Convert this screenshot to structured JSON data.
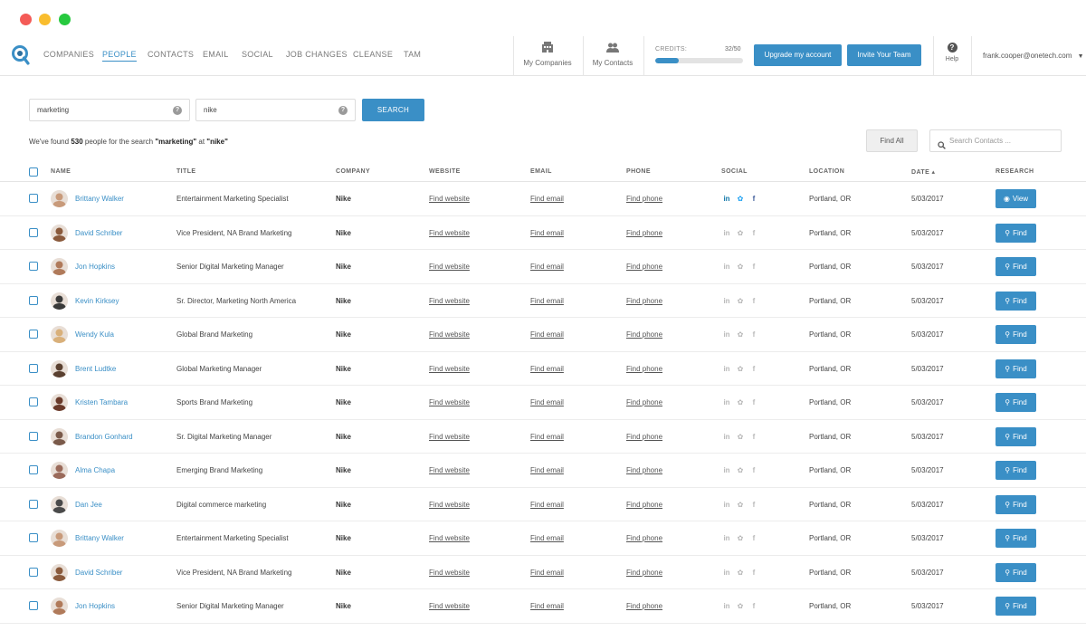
{
  "nav": {
    "links": [
      {
        "label": "COMPANIES",
        "active": false
      },
      {
        "label": "PEOPLE",
        "active": true
      },
      {
        "label": "CONTACTS",
        "active": false
      },
      {
        "label": "EMAIL",
        "active": false
      },
      {
        "label": "SOCIAL",
        "active": false
      },
      {
        "label": "JOB CHANGES",
        "active": false
      },
      {
        "label": "CLEANSE",
        "active": false
      },
      {
        "label": "TAM",
        "active": false
      }
    ],
    "my_companies": "My Companies",
    "my_contacts": "My Contacts",
    "credits_label": "CREDITS:",
    "credits_count": "32/50",
    "credits_progress": 0.27,
    "upgrade": "Upgrade my account",
    "invite": "Invite Your Team",
    "help": "Help",
    "user_email": "frank.cooper@onetech.com"
  },
  "search": {
    "keyword_value": "marketing",
    "company_value": "nike",
    "button": "SEARCH",
    "results_prefix": "We've found",
    "results_count": "530",
    "results_middle": "people for the search",
    "results_query": "\"marketing\"",
    "results_at": "at",
    "results_company": "\"nike\"",
    "find_all": "Find All",
    "contacts_placeholder": "Search Contacts ..."
  },
  "colors": {
    "accent": "#3a8fc6",
    "linkedin": "#0e76a8",
    "twitter": "#1da1f2",
    "facebook": "#3b5998",
    "social_inactive": "#b8b8b8"
  },
  "table": {
    "headers": [
      "NAME",
      "TITLE",
      "COMPANY",
      "WEBSITE",
      "EMAIL",
      "PHONE",
      "SOCIAL",
      "LOCATION",
      "DATE ▴",
      "RESEARCH"
    ],
    "rows": [
      {
        "name": "Brittany Walker",
        "title": "Entertainment Marketing Specialist",
        "company": "Nike",
        "website": "Find website",
        "email": "Find email",
        "phone": "Find phone",
        "social_active": true,
        "location": "Portland, OR",
        "date": "5/03/2017",
        "action": "View",
        "avatar": "#c89a7a"
      },
      {
        "name": "David Schriber",
        "title": "Vice President, NA Brand Marketing",
        "company": "Nike",
        "website": "Find website",
        "email": "Find email",
        "phone": "Find phone",
        "social_active": false,
        "location": "Portland, OR",
        "date": "5/03/2017",
        "action": "Find",
        "avatar": "#8a5a3c"
      },
      {
        "name": "Jon Hopkins",
        "title": "Senior Digital Marketing Manager",
        "company": "Nike",
        "website": "Find website",
        "email": "Find email",
        "phone": "Find phone",
        "social_active": false,
        "location": "Portland, OR",
        "date": "5/03/2017",
        "action": "Find",
        "avatar": "#b07a5a"
      },
      {
        "name": "Kevin Kirksey",
        "title": "Sr. Director, Marketing North America",
        "company": "Nike",
        "website": "Find website",
        "email": "Find email",
        "phone": "Find phone",
        "social_active": false,
        "location": "Portland, OR",
        "date": "5/03/2017",
        "action": "Find",
        "avatar": "#3a3a3a"
      },
      {
        "name": "Wendy Kula",
        "title": "Global Brand Marketing",
        "company": "Nike",
        "website": "Find website",
        "email": "Find email",
        "phone": "Find phone",
        "social_active": false,
        "location": "Portland, OR",
        "date": "5/03/2017",
        "action": "Find",
        "avatar": "#d9b07a"
      },
      {
        "name": "Brent Ludtke",
        "title": "Global Marketing Manager",
        "company": "Nike",
        "website": "Find website",
        "email": "Find email",
        "phone": "Find phone",
        "social_active": false,
        "location": "Portland, OR",
        "date": "5/03/2017",
        "action": "Find",
        "avatar": "#5a4030"
      },
      {
        "name": "Kristen Tambara",
        "title": "Sports Brand Marketing",
        "company": "Nike",
        "website": "Find website",
        "email": "Find email",
        "phone": "Find phone",
        "social_active": false,
        "location": "Portland, OR",
        "date": "5/03/2017",
        "action": "Find",
        "avatar": "#6a3a2a"
      },
      {
        "name": "Brandon Gonhard",
        "title": "Sr. Digital Marketing Manager",
        "company": "Nike",
        "website": "Find website",
        "email": "Find email",
        "phone": "Find phone",
        "social_active": false,
        "location": "Portland, OR",
        "date": "5/03/2017",
        "action": "Find",
        "avatar": "#7a5a4a"
      },
      {
        "name": "Alma Chapa",
        "title": "Emerging Brand Marketing",
        "company": "Nike",
        "website": "Find website",
        "email": "Find email",
        "phone": "Find phone",
        "social_active": false,
        "location": "Portland, OR",
        "date": "5/03/2017",
        "action": "Find",
        "avatar": "#9a6a5a"
      },
      {
        "name": "Dan Jee",
        "title": "Digital commerce marketing",
        "company": "Nike",
        "website": "Find website",
        "email": "Find email",
        "phone": "Find phone",
        "social_active": false,
        "location": "Portland, OR",
        "date": "5/03/2017",
        "action": "Find",
        "avatar": "#4a4a4a"
      },
      {
        "name": "Brittany Walker",
        "title": "Entertainment Marketing Specialist",
        "company": "Nike",
        "website": "Find website",
        "email": "Find email",
        "phone": "Find phone",
        "social_active": false,
        "location": "Portland, OR",
        "date": "5/03/2017",
        "action": "Find",
        "avatar": "#c89a7a"
      },
      {
        "name": "David Schriber",
        "title": "Vice President, NA Brand Marketing",
        "company": "Nike",
        "website": "Find website",
        "email": "Find email",
        "phone": "Find phone",
        "social_active": false,
        "location": "Portland, OR",
        "date": "5/03/2017",
        "action": "Find",
        "avatar": "#8a5a3c"
      },
      {
        "name": "Jon Hopkins",
        "title": "Senior Digital Marketing Manager",
        "company": "Nike",
        "website": "Find website",
        "email": "Find email",
        "phone": "Find phone",
        "social_active": false,
        "location": "Portland, OR",
        "date": "5/03/2017",
        "action": "Find",
        "avatar": "#b07a5a"
      }
    ]
  }
}
